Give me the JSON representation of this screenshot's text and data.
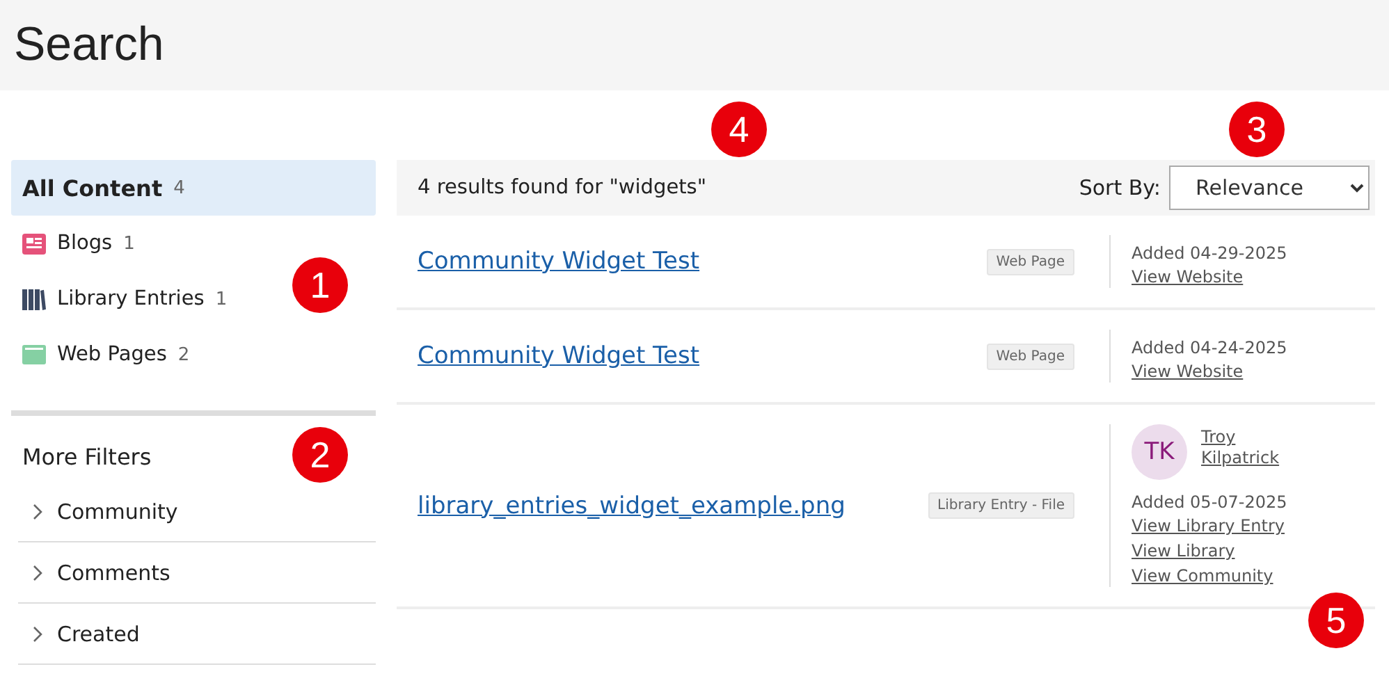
{
  "page": {
    "title": "Search"
  },
  "sidebar": {
    "items": [
      {
        "kind": "all",
        "label": "All Content",
        "count": "4",
        "selected": true
      },
      {
        "kind": "blog",
        "label": "Blogs",
        "count": "1",
        "selected": false
      },
      {
        "kind": "library",
        "label": "Library Entries",
        "count": "1",
        "selected": false
      },
      {
        "kind": "web",
        "label": "Web Pages",
        "count": "2",
        "selected": false
      }
    ],
    "filters_title": "More Filters",
    "filters": [
      {
        "label": "Community",
        "expanded": false
      },
      {
        "label": "Comments",
        "expanded": false
      },
      {
        "label": "Created",
        "expanded": false
      }
    ]
  },
  "results_bar": {
    "summary": "4 results found for \"widgets\"",
    "sort_label": "Sort By:",
    "sort_value": "Relevance"
  },
  "results": [
    {
      "title": "Community Widget Test",
      "tag": "Web Page",
      "added": "Added 04-29-2025",
      "links": [
        "View Website"
      ]
    },
    {
      "title": "Community Widget Test",
      "tag": "Web Page",
      "added": "Added 04-24-2025",
      "links": [
        "View Website"
      ]
    },
    {
      "title": "library_entries_widget_example.png",
      "tag": "Library Entry - File",
      "author": {
        "initials": "TK",
        "name_lines": [
          "Troy",
          "Kilpatrick"
        ]
      },
      "added": "Added 05-07-2025",
      "links": [
        "View Library Entry",
        "View Library",
        "View Community"
      ]
    }
  ],
  "callouts": [
    "1",
    "2",
    "3",
    "4",
    "5"
  ]
}
